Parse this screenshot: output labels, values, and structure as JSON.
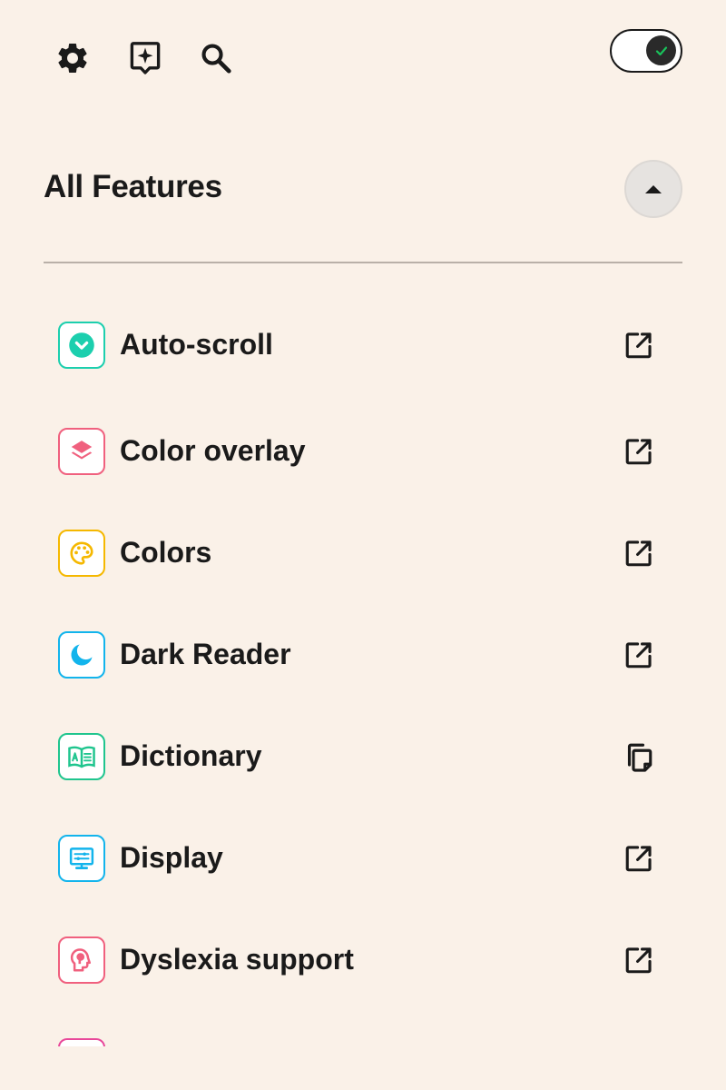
{
  "toolbar": {
    "settings_icon": "gear-icon",
    "feedback_icon": "sparkle-bubble-icon",
    "search_icon": "search-icon",
    "power_toggle": {
      "state": "on",
      "knob_icon": "check-icon"
    }
  },
  "section": {
    "title": "All Features",
    "collapse_icon": "caret-up-icon"
  },
  "colors": {
    "background": "#faf1e8",
    "teal": "#1ccfae",
    "pink": "#f0607e",
    "yellow": "#f5b800",
    "sky": "#12b4ec",
    "green": "#1fc58e"
  },
  "features": [
    {
      "label": "Auto-scroll",
      "icon": "chevron-circle-icon",
      "color": "#1ccfae",
      "action": "open-external-icon"
    },
    {
      "label": "Color overlay",
      "icon": "layers-icon",
      "color": "#f0607e",
      "action": "open-external-icon"
    },
    {
      "label": "Colors",
      "icon": "palette-icon",
      "color": "#f5b800",
      "action": "open-external-icon"
    },
    {
      "label": "Dark Reader",
      "icon": "moon-icon",
      "color": "#12b4ec",
      "action": "open-external-icon"
    },
    {
      "label": "Dictionary",
      "icon": "book-icon",
      "color": "#1fc58e",
      "action": "copy-icon"
    },
    {
      "label": "Display",
      "icon": "monitor-icon",
      "color": "#12b4ec",
      "action": "open-external-icon"
    },
    {
      "label": "Dyslexia support",
      "icon": "head-icon",
      "color": "#f0607e",
      "action": "open-external-icon"
    }
  ]
}
